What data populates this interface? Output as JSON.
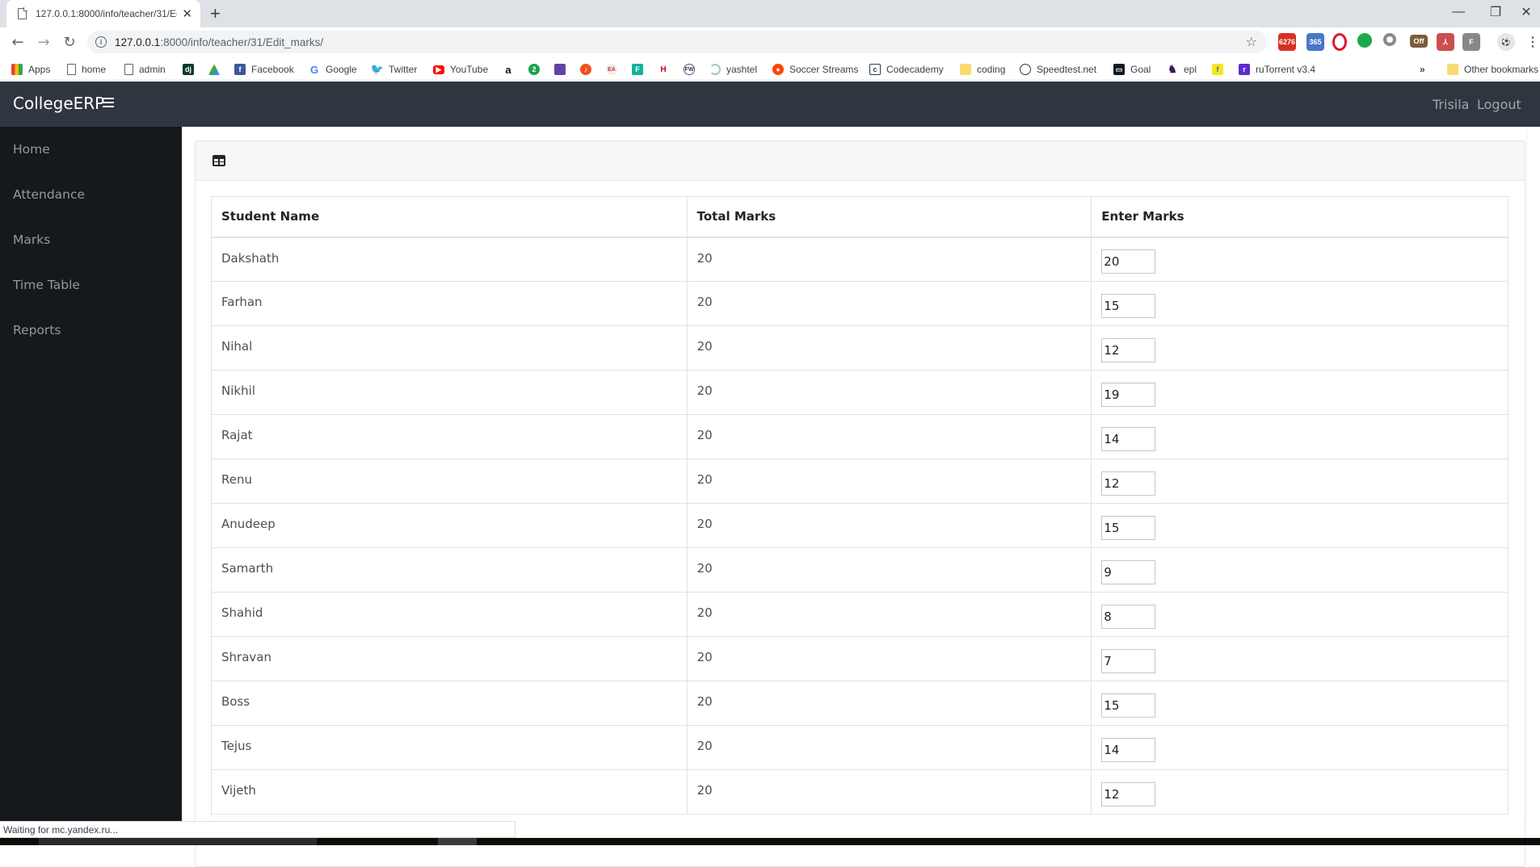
{
  "browser": {
    "tab_title": "127.0.0.1:8000/info/teacher/31/Edit_marks/",
    "url_host": "127.0.0.1",
    "url_rest": ":8000/info/teacher/31/Edit_marks/",
    "bookmarks": [
      {
        "label": "Apps",
        "icon": "apps-grid-icon"
      },
      {
        "label": "home",
        "icon": "page-icon"
      },
      {
        "label": "admin",
        "icon": "page-icon"
      },
      {
        "label": "",
        "icon": "django-icon"
      },
      {
        "label": "",
        "icon": "google-drive-icon"
      },
      {
        "label": "Facebook",
        "icon": "facebook-icon"
      },
      {
        "label": "Google",
        "icon": "google-icon"
      },
      {
        "label": "Twitter",
        "icon": "twitter-icon"
      },
      {
        "label": "YouTube",
        "icon": "youtube-icon"
      },
      {
        "label": "",
        "icon": "amazon-icon"
      },
      {
        "label": "",
        "icon": "green-2-icon"
      },
      {
        "label": "",
        "icon": "twitch-icon"
      },
      {
        "label": "",
        "icon": "music-icon"
      },
      {
        "label": "",
        "icon": "ea-icon"
      },
      {
        "label": "",
        "icon": "f-icon"
      },
      {
        "label": "",
        "icon": "hero-icon"
      },
      {
        "label": "",
        "icon": "fw-icon"
      },
      {
        "label": "yashtel",
        "icon": "loading-icon"
      },
      {
        "label": "Soccer Streams",
        "icon": "reddit-icon"
      },
      {
        "label": "Codecademy",
        "icon": "codecademy-icon"
      },
      {
        "label": "coding",
        "icon": "folder-icon"
      },
      {
        "label": "Speedtest.net",
        "icon": "speedtest-icon"
      },
      {
        "label": "Goal",
        "icon": "goal-icon"
      },
      {
        "label": "epl",
        "icon": "premier-league-icon"
      },
      {
        "label": "",
        "icon": "flipkart-icon"
      },
      {
        "label": "ruTorrent v3.4",
        "icon": "rutorrent-icon"
      }
    ],
    "overflow_label": "»",
    "other_bookmarks": "Other bookmarks",
    "extensions": {
      "gmail_badge": "6276",
      "off_badge": "Off"
    },
    "status_text": "Waiting for mc.yandex.ru..."
  },
  "app": {
    "brand": "CollegeERP",
    "user": "Trisila",
    "logout": "Logout",
    "sidebar": [
      "Home",
      "Attendance",
      "Marks",
      "Time Table",
      "Reports"
    ],
    "table": {
      "headers": [
        "Student Name",
        "Total Marks",
        "Enter Marks"
      ],
      "rows": [
        {
          "name": "Dakshath",
          "total": "20",
          "marks": "20"
        },
        {
          "name": "Farhan",
          "total": "20",
          "marks": "15"
        },
        {
          "name": "Nihal",
          "total": "20",
          "marks": "12"
        },
        {
          "name": "Nikhil",
          "total": "20",
          "marks": "19"
        },
        {
          "name": "Rajat",
          "total": "20",
          "marks": "14"
        },
        {
          "name": "Renu",
          "total": "20",
          "marks": "12"
        },
        {
          "name": "Anudeep",
          "total": "20",
          "marks": "15"
        },
        {
          "name": "Samarth",
          "total": "20",
          "marks": "9"
        },
        {
          "name": "Shahid",
          "total": "20",
          "marks": "8"
        },
        {
          "name": "Shravan",
          "total": "20",
          "marks": "7"
        },
        {
          "name": "Boss",
          "total": "20",
          "marks": "15"
        },
        {
          "name": "Tejus",
          "total": "20",
          "marks": "14"
        },
        {
          "name": "Vijeth",
          "total": "20",
          "marks": "12"
        }
      ]
    }
  }
}
